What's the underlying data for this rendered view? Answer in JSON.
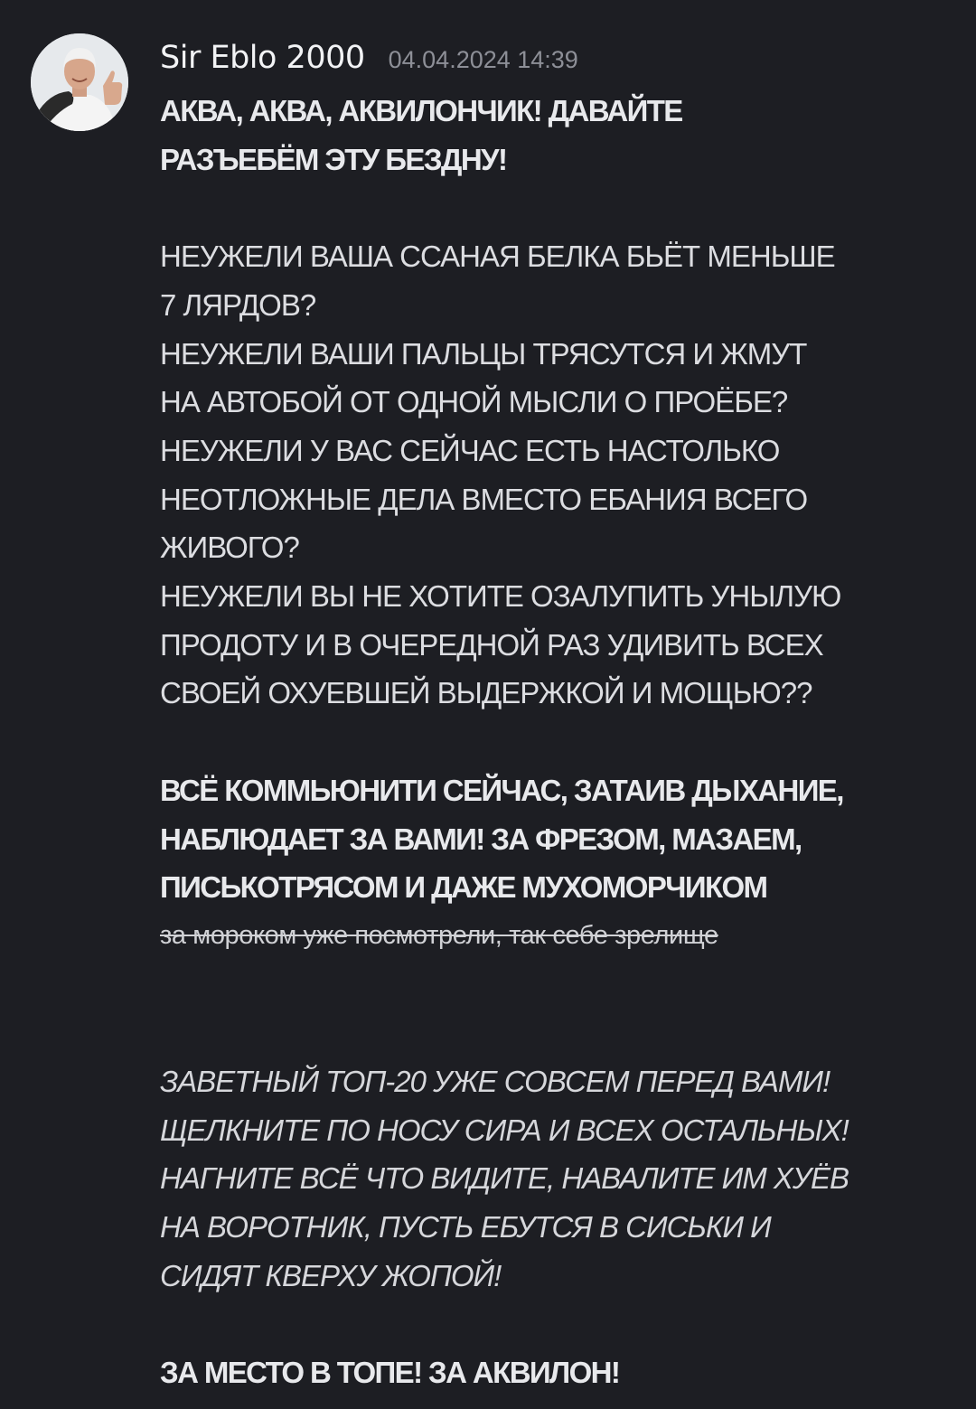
{
  "message": {
    "author": "Sir Eblo 2000",
    "timestamp": "04.04.2024 14:39",
    "paragraphs": {
      "p1": [
        "АКВА, АКВА, АКВИЛОНЧИК! ДАВАЙТЕ",
        "РАЗЪЕБЁМ ЭТУ БЕЗДНУ!"
      ],
      "p2": [
        "НЕУЖЕЛИ ВАША ССАНАЯ БЕЛКА БЬЁТ МЕНЬШЕ",
        "7 ЛЯРДОВ?",
        "НЕУЖЕЛИ ВАШИ ПАЛЬЦЫ ТРЯСУТСЯ И ЖМУТ",
        "НА АВТОБОЙ ОТ ОДНОЙ МЫСЛИ О ПРОЁБЕ?",
        "НЕУЖЕЛИ У ВАС СЕЙЧАС ЕСТЬ НАСТОЛЬКО",
        "НЕОТЛОЖНЫЕ ДЕЛА ВМЕСТО ЕБАНИЯ ВСЕГО",
        "ЖИВОГО?",
        "НЕУЖЕЛИ ВЫ НЕ ХОТИТЕ ОЗАЛУПИТЬ УНЫЛУЮ",
        "ПРОДОТУ И В ОЧЕРЕДНОЙ РАЗ УДИВИТЬ ВСЕХ",
        "СВОЕЙ ОХУЕВШЕЙ ВЫДЕРЖКОЙ И МОЩЬЮ??"
      ],
      "p3": [
        "ВСЁ КОММЬЮНИТИ СЕЙЧАС, ЗАТАИВ ДЫХАНИЕ,",
        "НАБЛЮДАЕТ ЗА ВАМИ! ЗА ФРЕЗОМ, МАЗАЕМ,",
        "ПИСЬКОТРЯСОМ И ДАЖЕ МУХОМОРЧИКОМ"
      ],
      "strike": "за мороком уже посмотрели, так себе зрелище",
      "p4": [
        "ЗАВЕТНЫЙ ТОП-20 УЖЕ СОВСЕМ ПЕРЕД ВАМИ!",
        "ЩЕЛКНИТЕ ПО НОСУ СИРА И ВСЕХ ОСТАЛЬНЫХ!",
        "НАГНИТЕ ВСЁ ЧТО ВИДИТЕ, НАВАЛИТЕ ИМ ХУЁВ",
        "НА ВОРОТНИК, ПУСТЬ ЕБУТСЯ В СИСЬКИ И",
        "СИДЯТ КВЕРХУ ЖОПОЙ!"
      ],
      "p5": "ЗА МЕСТО В ТОПЕ! ЗА АКВИЛОН!"
    }
  }
}
